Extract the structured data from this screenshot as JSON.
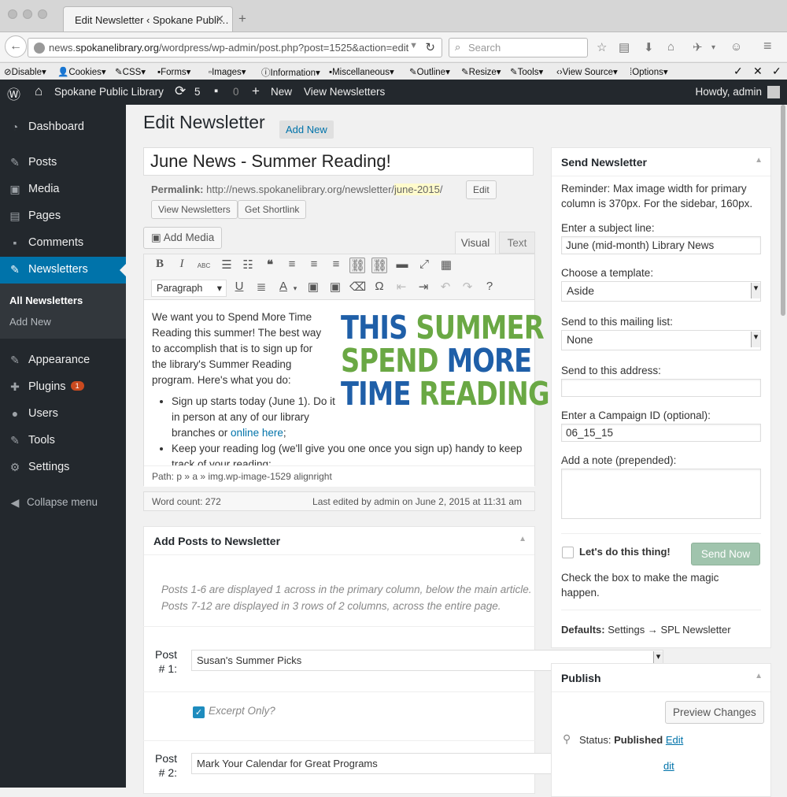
{
  "browser": {
    "tab_title": "Edit Newsletter ‹ Spokane Publi…",
    "tab_close": "✕",
    "new_tab": "+",
    "url_prefix": "news.",
    "url_domain": "spokanelibrary.org",
    "url_path": "/wordpress/wp-admin/post.php?post=1525&action=edit",
    "search_placeholder": "Search"
  },
  "devbar": {
    "items": [
      "Disable",
      "Cookies",
      "CSS",
      "Forms",
      "Images",
      "Information",
      "Miscellaneous",
      "Outline",
      "Resize",
      "Tools",
      "View Source",
      "Options"
    ]
  },
  "adminbar": {
    "site_name": "Spokane Public Library",
    "updates": "5",
    "comments": "0",
    "new_label": "New",
    "view_label": "View Newsletters",
    "howdy": "Howdy, admin"
  },
  "sidebar": {
    "items": [
      {
        "label": "Dashboard",
        "icon": "dashboard-icon"
      },
      {
        "label": "Posts",
        "icon": "pin-icon"
      },
      {
        "label": "Media",
        "icon": "media-icon"
      },
      {
        "label": "Pages",
        "icon": "pages-icon"
      },
      {
        "label": "Comments",
        "icon": "comment-icon"
      },
      {
        "label": "Newsletters",
        "icon": "pin-icon"
      },
      {
        "label": "Appearance",
        "icon": "brush-icon"
      },
      {
        "label": "Plugins",
        "icon": "plug-icon"
      },
      {
        "label": "Users",
        "icon": "user-icon"
      },
      {
        "label": "Tools",
        "icon": "wrench-icon"
      },
      {
        "label": "Settings",
        "icon": "settings-icon"
      }
    ],
    "plugins_badge": "1",
    "submenu": [
      "All Newsletters",
      "Add New"
    ],
    "collapse": "Collapse menu"
  },
  "page": {
    "heading": "Edit Newsletter",
    "add_new": "Add New",
    "title": "June News - Summer Reading!",
    "permalink_label": "Permalink:",
    "permalink_base": "http://news.spokanelibrary.org/newsletter/",
    "permalink_slug": "june-2015",
    "permalink_end": "/",
    "edit_btn": "Edit",
    "view_btn": "View Newsletters",
    "shortlink_btn": "Get Shortlink",
    "add_media": "Add Media",
    "tab_visual": "Visual",
    "tab_text": "Text",
    "format": "Paragraph"
  },
  "editor": {
    "para1": "We want you to Spend More Time Reading this summer! The best way to accomplish that is to sign up for the library's Summer Reading program. Here's what you do:",
    "bullet1_pre": "Sign up starts today (June 1). Do it in person at any of our library branches or ",
    "bullet1_link": "online here",
    "bullet1_post": ";",
    "bullet2": "Keep your reading log (we'll give you one once you sign up) handy to keep track of your reading;",
    "hero_line1a": "THIS ",
    "hero_line1b": "SUMMER",
    "hero_line2a": "SPEND ",
    "hero_line2b": "MORE",
    "hero_line3a": "TIME ",
    "hero_line3b": "READING",
    "hero_line3c": "!",
    "path": "Path: p » a » img.wp-image-1529 alignright",
    "word_count": "Word count: 272",
    "last_edited": "Last edited by admin on June 2, 2015 at 11:31 am"
  },
  "add_posts": {
    "heading": "Add Posts to Newsletter",
    "note1": "Posts 1-6 are displayed 1 across in the primary column, below the main article.",
    "note2": "Posts 7-12 are displayed in 3 rows of 2 columns, across the entire page.",
    "post1_label": "Post # 1:",
    "post1_value": "Susan's Summer Picks",
    "excerpt_label": "Excerpt Only?",
    "post2_label": "Post # 2:",
    "post2_value": "Mark Your Calendar for Great Programs"
  },
  "send_newsletter": {
    "heading": "Send Newsletter",
    "reminder": "Reminder: Max image width for primary column is 370px. For the sidebar, 160px.",
    "subject_label": "Enter a subject line:",
    "subject_value": "June (mid-month) Library News",
    "template_label": "Choose a template:",
    "template_value": "Aside",
    "list_label": "Send to this mailing list:",
    "list_value": "None",
    "address_label": "Send to this address:",
    "address_value": "",
    "campaign_label": "Enter a Campaign ID (optional):",
    "campaign_value": "06_15_15",
    "note_label": "Add a note (prepended):",
    "confirm_label": "Let's do this thing!",
    "send_btn": "Send Now",
    "help": "Check the box to make the magic happen.",
    "defaults_label": "Defaults:",
    "defaults_value": "Settings → SPL Newsletter"
  },
  "publish": {
    "heading": "Publish",
    "preview_btn": "Preview Changes",
    "status_label": "Status:",
    "status_value": "Published",
    "edit_link": "Edit",
    "edit_link2": "dit"
  },
  "colors": {
    "hero_blue": "#1f5fa8",
    "hero_green": "#6aa844",
    "hero_orange": "#f0a41c",
    "admin_dark": "#23282d",
    "accent": "#0073aa"
  }
}
